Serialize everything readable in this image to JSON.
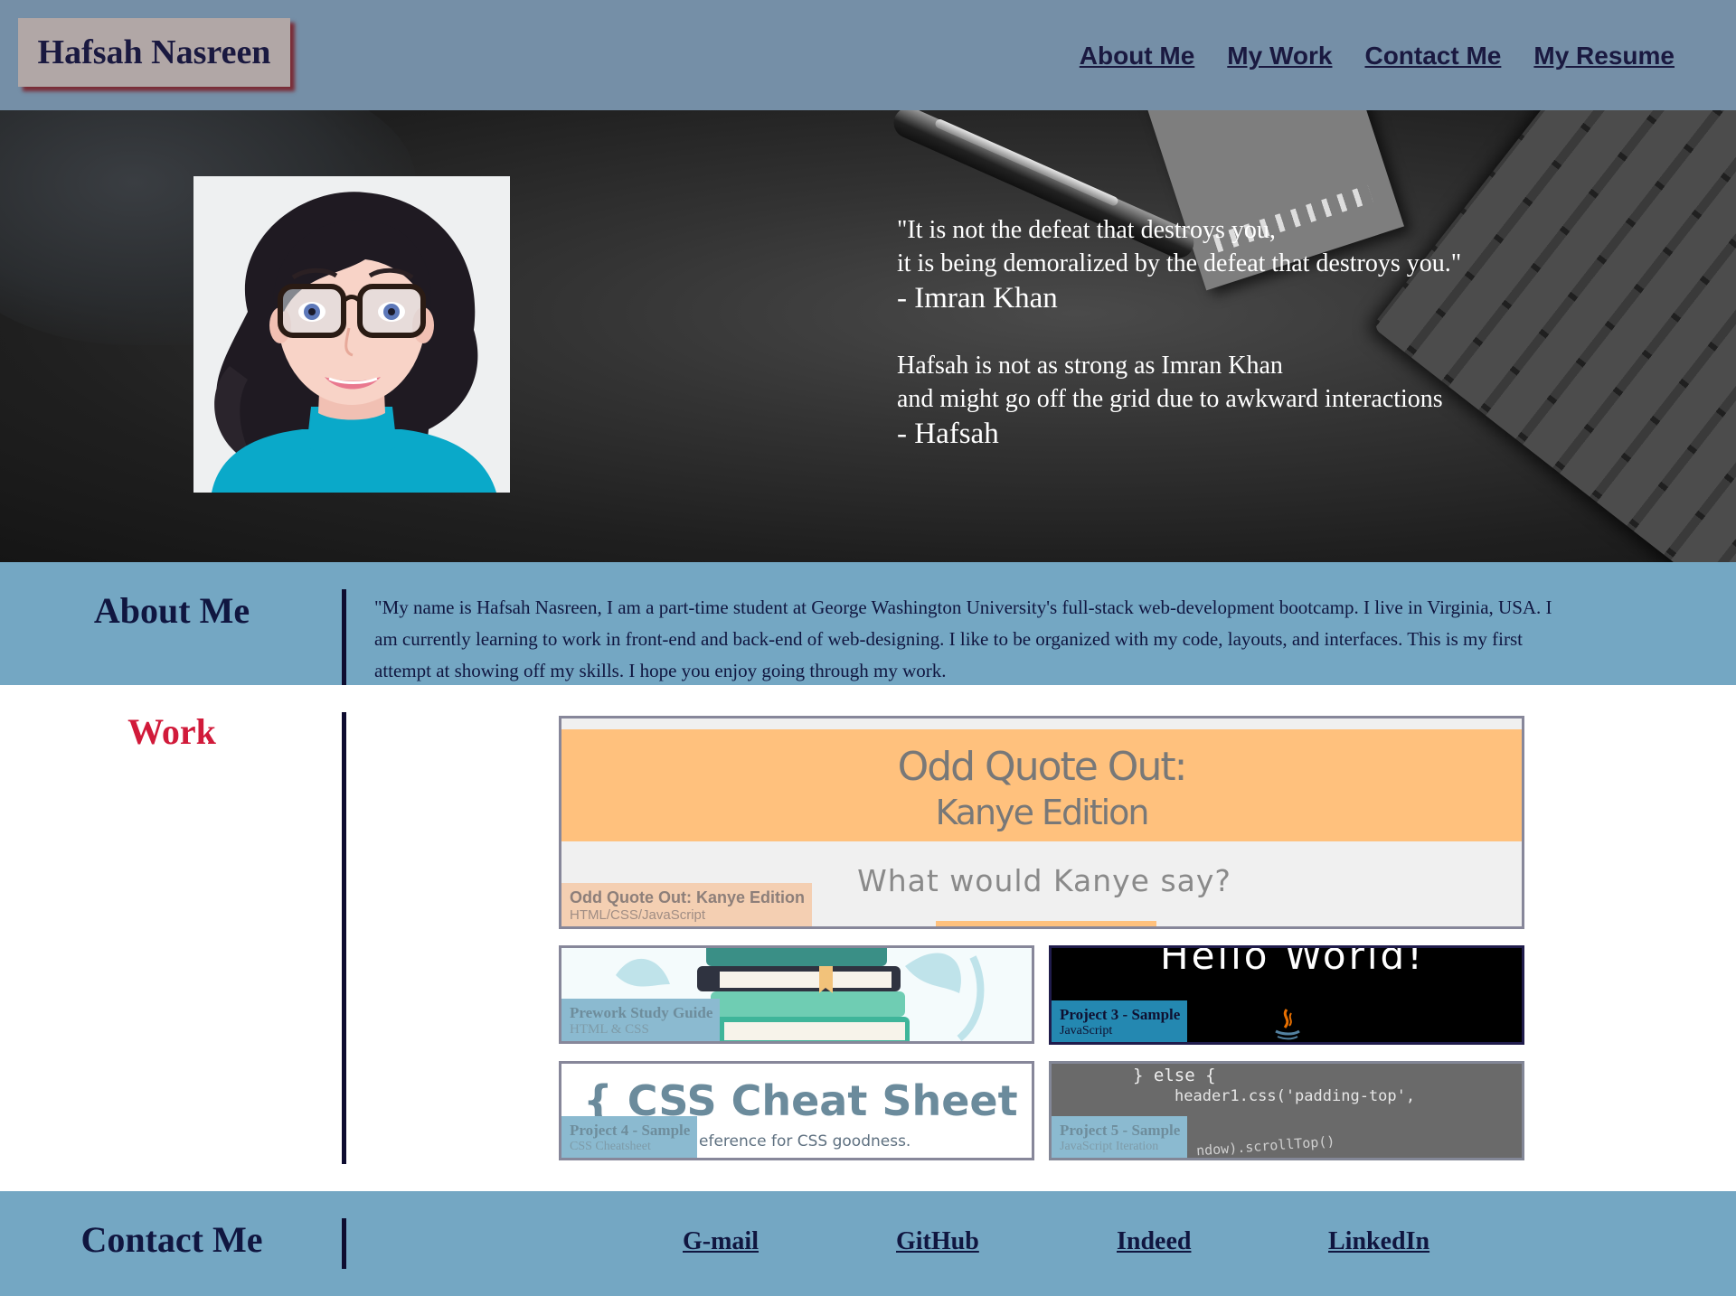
{
  "header": {
    "brand": "Hafsah Nasreen",
    "nav": [
      "About Me",
      "My Work",
      "Contact Me",
      "My Resume"
    ]
  },
  "hero": {
    "quote_lines": [
      "\"It is not the defeat that destroys you,",
      "it is being demoralized by the defeat that destroys you.\""
    ],
    "quote_author": "- Imran Khan",
    "note_lines": [
      "Hafsah is not as strong as Imran Khan",
      "and might go off the grid due to awkward interactions"
    ],
    "note_author": "- Hafsah"
  },
  "about": {
    "title": "About Me",
    "text": "\"My name is Hafsah Nasreen, I am a part-time student at George Washington University's full-stack web-development bootcamp. I live in Virginia, USA. I am currently learning to work in front-end and back-end of web-designing. I like to be organized with my code, layouts, and interfaces. This is my first attempt at showing off my skills. I hope you enjoy going through my work."
  },
  "work": {
    "title": "Work",
    "cards": [
      {
        "title": "Odd Quote Out: Kanye Edition",
        "subtitle": "HTML/CSS/JavaScript",
        "image_text": [
          "Odd Quote Out:",
          "Kanye Edition",
          "What would Kanye say?"
        ]
      },
      {
        "title": "Prework Study Guide",
        "subtitle": "HTML & CSS"
      },
      {
        "title": "Project 3 - Sample",
        "subtitle": "JavaScript",
        "image_text": [
          "Hello World!"
        ]
      },
      {
        "title": "Project 4 - Sample",
        "subtitle": "CSS Cheatsheet",
        "image_text": [
          "{ CSS Cheat Sheet }",
          "eference for CSS goodness."
        ]
      },
      {
        "title": "Project 5 - Sample",
        "subtitle": "JavaScript Iteration",
        "image_text": [
          "} else {",
          "header1.css('padding-top',",
          "ndow).scrollTop()"
        ]
      }
    ]
  },
  "contact": {
    "title": "Contact Me",
    "links": [
      "G-mail",
      "GitHub",
      "Indeed",
      "LinkedIn"
    ]
  },
  "colors": {
    "header_bg": "#758fa7",
    "section_bg": "#74a7c3",
    "accent_work": "#d11a3a",
    "text_dark": "#101640"
  }
}
